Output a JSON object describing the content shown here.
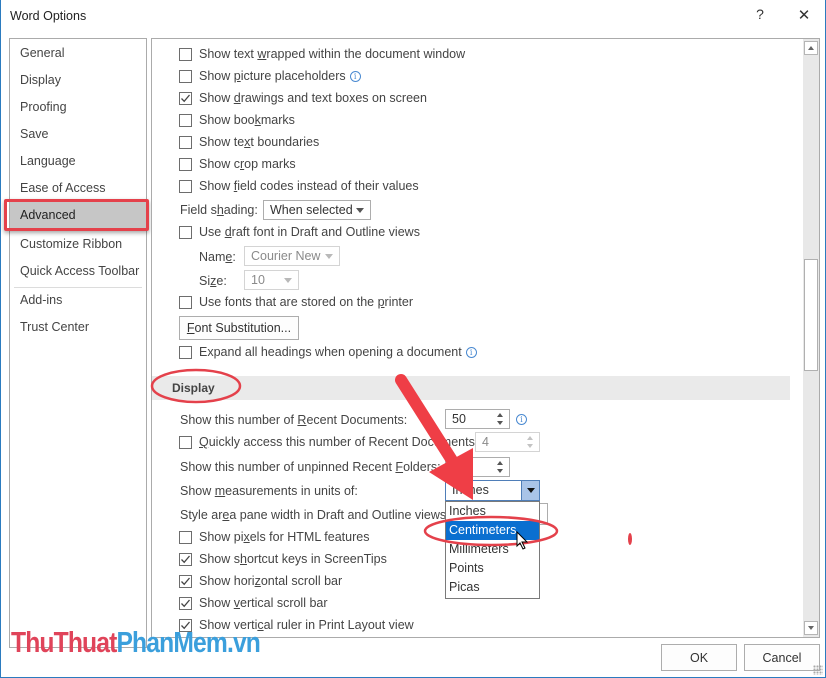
{
  "window": {
    "title": "Word Options",
    "help_label": "?",
    "close_label": "✕"
  },
  "sidebar": {
    "items": [
      {
        "label": "General"
      },
      {
        "label": "Display"
      },
      {
        "label": "Proofing"
      },
      {
        "label": "Save"
      },
      {
        "label": "Language"
      },
      {
        "label": "Ease of Access"
      },
      {
        "label": "Advanced",
        "active": true
      },
      {
        "label": "Customize Ribbon"
      },
      {
        "label": "Quick Access Toolbar"
      },
      {
        "label": "Add-ins"
      },
      {
        "label": "Trust Center"
      }
    ]
  },
  "content": {
    "options_top": [
      {
        "pre": "Show text ",
        "u": "w",
        "post": "rapped within the document window",
        "checked": false
      },
      {
        "pre": "Show ",
        "u": "p",
        "post": "icture placeholders",
        "checked": false,
        "info": true
      },
      {
        "pre": "Show ",
        "u": "d",
        "post": "rawings and text boxes on screen",
        "checked": true
      },
      {
        "pre": "Show boo",
        "u": "k",
        "post": "marks",
        "checked": false
      },
      {
        "pre": "Show te",
        "u": "x",
        "post": "t boundaries",
        "checked": false
      },
      {
        "pre": "Show c",
        "u": "r",
        "post": "op marks",
        "checked": false
      },
      {
        "pre": "Show ",
        "u": "f",
        "post": "ield codes instead of their values",
        "checked": false
      }
    ],
    "field_shading": {
      "label_pre": "Field s",
      "label_u": "h",
      "label_post": "ading:",
      "value": "When selected"
    },
    "draft_font": {
      "pre": "Use ",
      "u": "d",
      "post": "raft font in Draft and Outline views",
      "checked": false
    },
    "name": {
      "label_pre": "Nam",
      "label_u": "e",
      "label_post": ":",
      "value": "Courier New"
    },
    "size": {
      "label_pre": "Si",
      "label_u": "z",
      "label_post": "e:",
      "value": "10"
    },
    "printer_fonts": {
      "pre": "Use fonts that are stored on the ",
      "u": "p",
      "post": "rinter",
      "checked": false
    },
    "font_substitution": {
      "u": "F",
      "post": "ont Substitution..."
    },
    "expand_headings": {
      "pre": "Expand all headings when opening a document",
      "u": "",
      "post": "",
      "checked": false,
      "info": true
    },
    "display_section": {
      "title": "Display",
      "recent_docs": {
        "label_pre": "Show this number of ",
        "label_u": "R",
        "label_post": "ecent Documents:",
        "value": "50"
      },
      "quick_access": {
        "pre": "",
        "u": "Q",
        "post": "uickly access this number of Recent Documents:",
        "checked": false,
        "value": "4"
      },
      "recent_folders": {
        "label_pre": "Show this number of unpinned Recent ",
        "label_u": "F",
        "label_post": "olders:",
        "value": ""
      },
      "units": {
        "label_pre": "Show ",
        "label_u": "m",
        "label_post": "easurements in units of:",
        "value": "Inches",
        "options": [
          "Inches",
          "Centimeters",
          "Millimeters",
          "Points",
          "Picas"
        ],
        "highlighted": "Centimeters"
      },
      "style_pane": {
        "label_pre": "Style ar",
        "label_u": "e",
        "label_post": "a pane width in Draft and Outline views:"
      },
      "options": [
        {
          "pre": "Show pi",
          "u": "x",
          "post": "els for HTML features",
          "checked": false
        },
        {
          "pre": "Show s",
          "u": "h",
          "post": "ortcut keys in ScreenTips",
          "checked": true
        },
        {
          "pre": "Show hori",
          "u": "z",
          "post": "ontal scroll bar",
          "checked": true
        },
        {
          "pre": "Show ",
          "u": "v",
          "post": "ertical scroll bar",
          "checked": true
        },
        {
          "pre": "Show verti",
          "u": "c",
          "post": "al ruler in Print Layout view",
          "checked": true
        }
      ]
    }
  },
  "footer": {
    "ok_label": "OK",
    "cancel_label": "Cancel"
  },
  "watermark": {
    "part1": "ThuThuat",
    "part2": "PhanMem.vn"
  },
  "annotation_color": "#e4414b"
}
